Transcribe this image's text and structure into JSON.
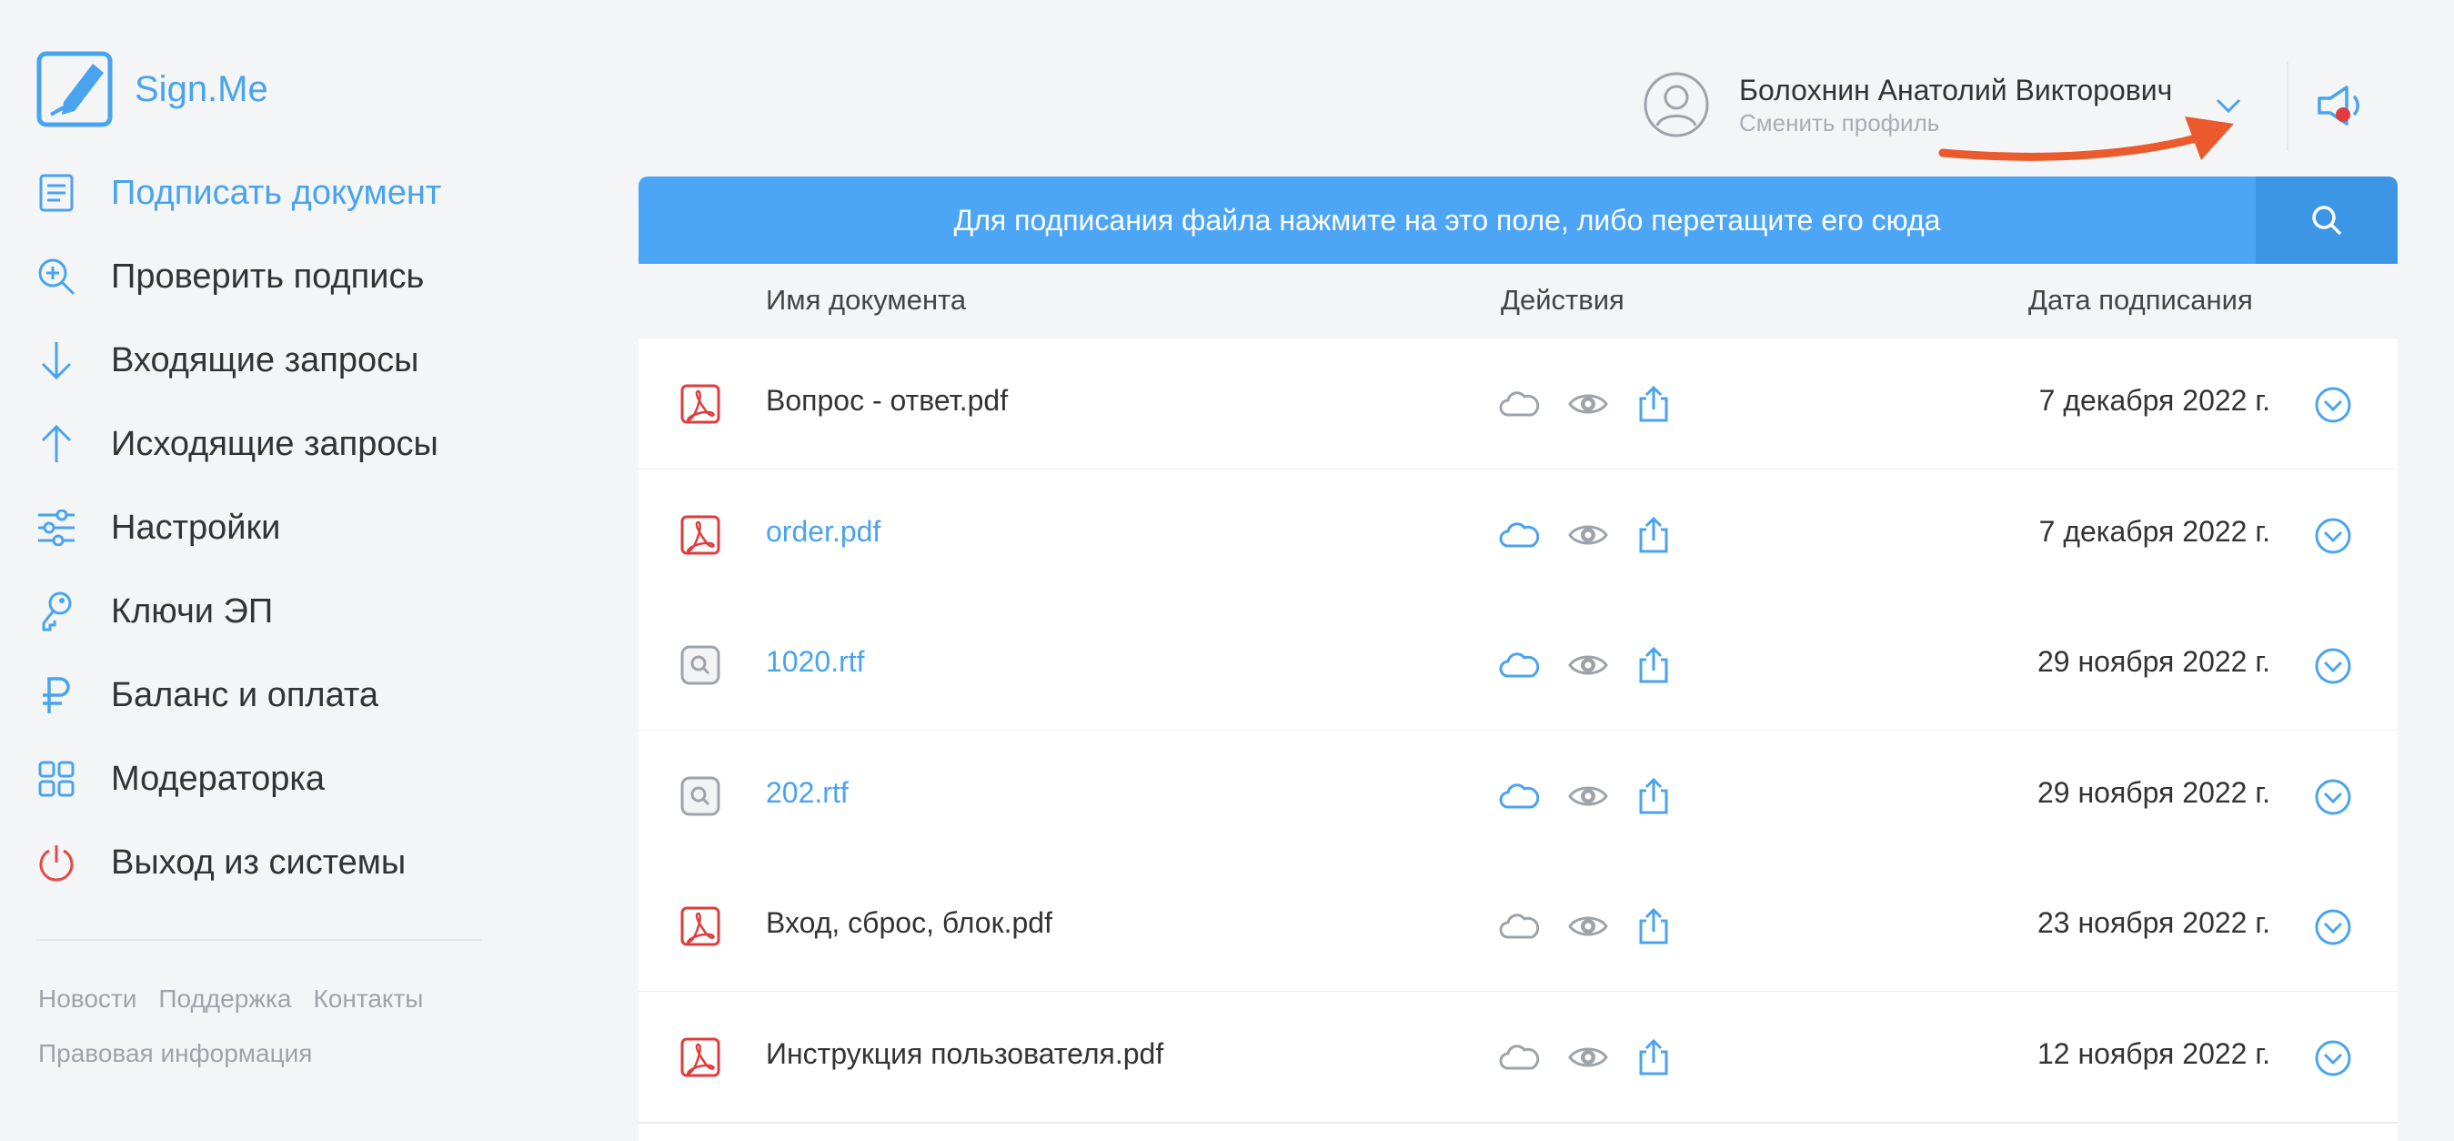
{
  "app": {
    "name": "Sign.Me"
  },
  "sidebar": {
    "items": [
      {
        "label": "Подписать документ",
        "icon": "document-icon",
        "active": true
      },
      {
        "label": "Проверить подпись",
        "icon": "search-plus-icon",
        "active": false
      },
      {
        "label": "Входящие запросы",
        "icon": "arrow-down-icon",
        "active": false
      },
      {
        "label": "Исходящие запросы",
        "icon": "arrow-up-icon",
        "active": false
      },
      {
        "label": "Настройки",
        "icon": "sliders-icon",
        "active": false
      },
      {
        "label": "Ключи ЭП",
        "icon": "key-icon",
        "active": false
      },
      {
        "label": "Баланс и оплата",
        "icon": "ruble-icon",
        "active": false
      },
      {
        "label": "Модераторка",
        "icon": "grid-icon",
        "active": false
      },
      {
        "label": "Выход из системы",
        "icon": "power-icon",
        "active": false
      }
    ],
    "footer": {
      "news": "Новости",
      "support": "Поддержка",
      "contacts": "Контакты",
      "legal": "Правовая информация"
    }
  },
  "header": {
    "user_name": "Болохнин Анатолий Викторович",
    "switch_profile": "Сменить профиль"
  },
  "main": {
    "dropzone_text": "Для подписания файла нажмите на это поле, либо перетащите его сюда",
    "columns": {
      "name": "Имя документа",
      "actions": "Действия",
      "date": "Дата подписания"
    },
    "rows": [
      {
        "name": "Вопрос - ответ.pdf",
        "type": "pdf",
        "link": false,
        "cloud": false,
        "date": "7 декабря 2022 г."
      },
      {
        "name": "order.pdf",
        "type": "pdf",
        "link": true,
        "cloud": true,
        "date": "7 декабря 2022 г."
      },
      {
        "name": "1020.rtf",
        "type": "rtf",
        "link": true,
        "cloud": true,
        "date": "29 ноября 2022 г."
      },
      {
        "name": "202.rtf",
        "type": "rtf",
        "link": true,
        "cloud": true,
        "date": "29 ноября 2022 г."
      },
      {
        "name": "Вход, сброс, блок.pdf",
        "type": "pdf",
        "link": false,
        "cloud": false,
        "date": "23 ноября 2022 г."
      },
      {
        "name": "Инструкция пользователя.pdf",
        "type": "pdf",
        "link": false,
        "cloud": false,
        "date": "12 ноября 2022 г."
      }
    ]
  },
  "colors": {
    "accent": "#4aa3ee",
    "dropbar": "#4da6f5",
    "pdf_red": "#e03c3c",
    "annotation_arrow": "#ea5a2c"
  }
}
